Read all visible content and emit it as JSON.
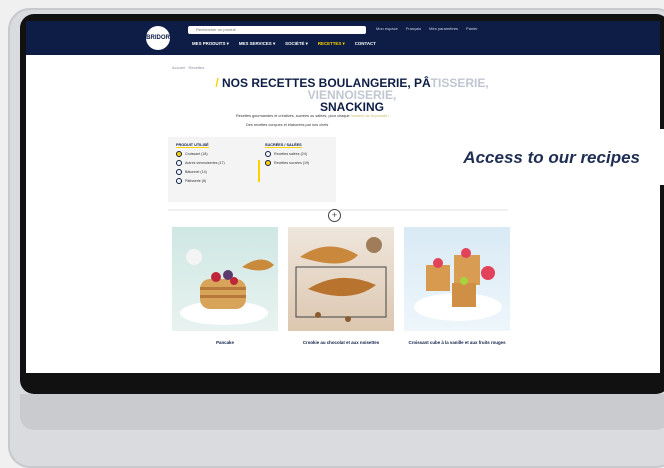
{
  "site": {
    "search_placeholder": "Rechercher un produit",
    "top_links": [
      "Mon espace",
      "Français",
      "Mes paramètres",
      "Panier"
    ],
    "logo_text": "BRIDOR",
    "nav": [
      "MES PRODUITS ▾",
      "MES SERVICES ▾",
      "SOCIÉTÉ ▾",
      "RECETTES ▾",
      "CONTACT"
    ],
    "active_nav_index": 3,
    "breadcrumb": "Accueil · Recettes"
  },
  "page": {
    "title_main": "NOS RECETTES BOULANGERIE, PÂ",
    "title_light": "TISSERIE, VIENNOISERIE,",
    "title_line2": "SNACKING",
    "intro_line1": "Recettes gourmandes et créatives, sucrées ou salées, pour chaque ",
    "intro_link": "moment de la journée !",
    "intro_line2": "Des recettes conçues et élaborées par nos chefs"
  },
  "filters": {
    "product": {
      "heading": "PRODUIT UTILISÉ",
      "items": [
        "Croissant (18)",
        "Autres viennoiseries (17)",
        "Bâtonnet (14)",
        "Pâtisserie (6)"
      ]
    },
    "taste": {
      "heading": "SUCRÉES / SALÉES",
      "items": [
        "Recettes salées (24)",
        "Recettes sucrées (19)"
      ]
    },
    "add_symbol": "+"
  },
  "recipes": [
    {
      "name": "Pancake"
    },
    {
      "name": "Crookie au chocolat et aux noisettes"
    },
    {
      "name": "Croissant cube à la vanille et aux fruits rouges"
    }
  ],
  "banner": {
    "text": "Access to our recipes"
  },
  "colors": {
    "navy": "#0e1d45",
    "accent": "#ffd200"
  }
}
